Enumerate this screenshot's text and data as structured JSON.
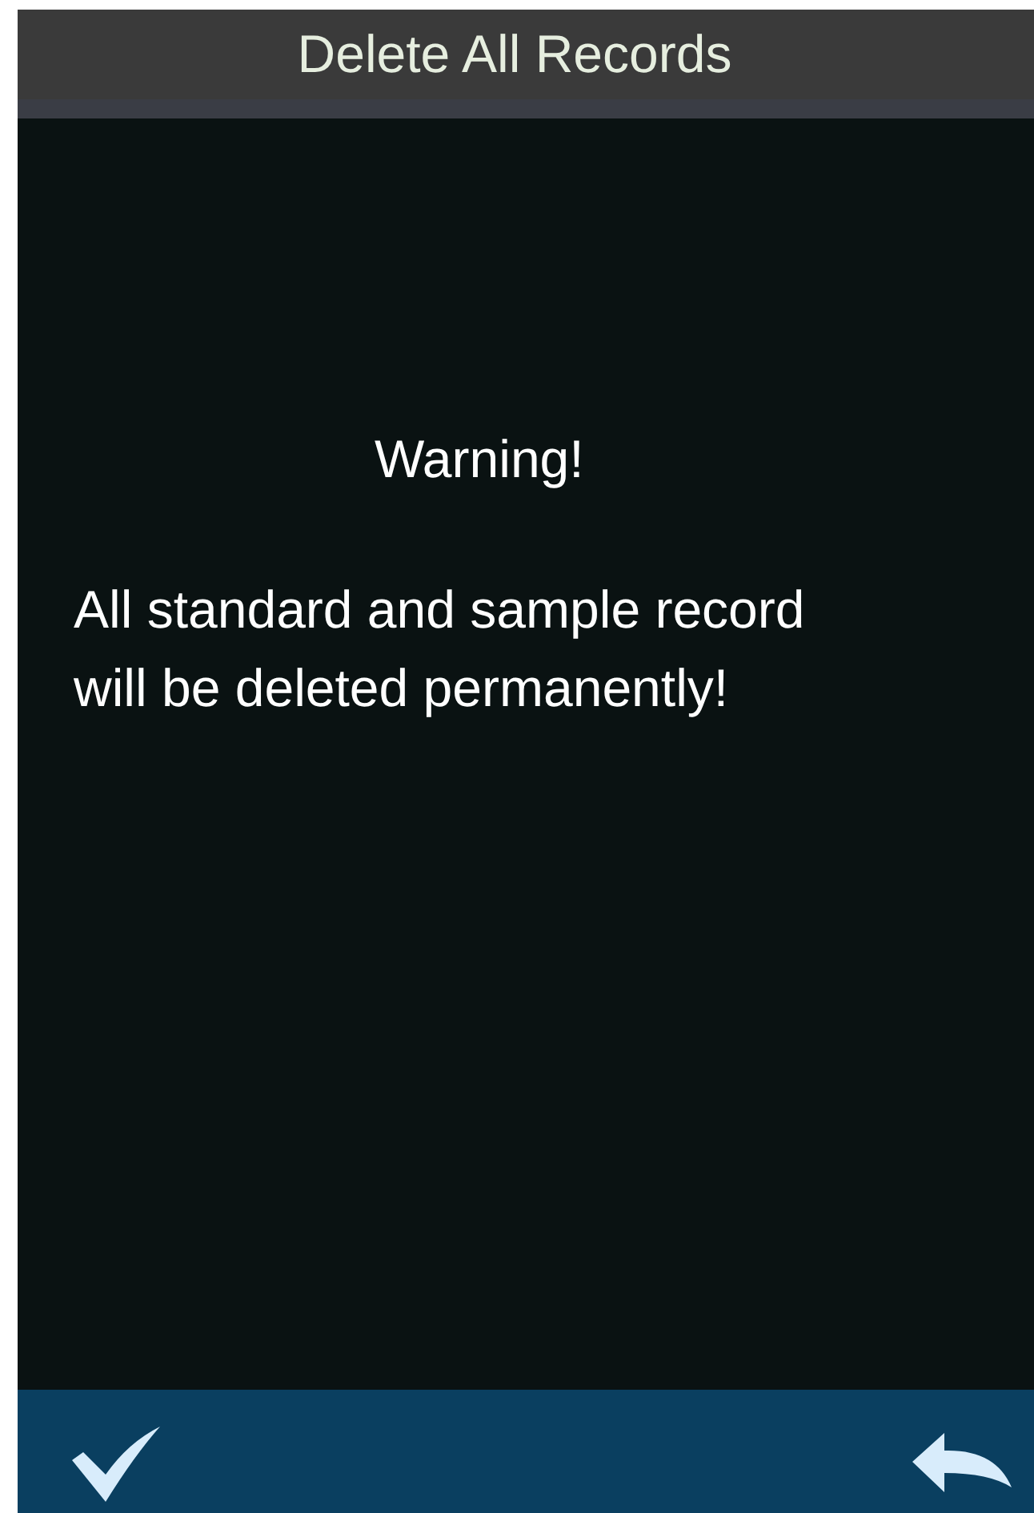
{
  "header": {
    "title": "Delete All Records"
  },
  "dialog": {
    "heading": "Warning!",
    "message": "All standard and sample record\nwill be deleted permanently!"
  },
  "footer": {
    "buttons": [
      {
        "kind": "confirm"
      },
      {
        "kind": "back"
      }
    ]
  }
}
